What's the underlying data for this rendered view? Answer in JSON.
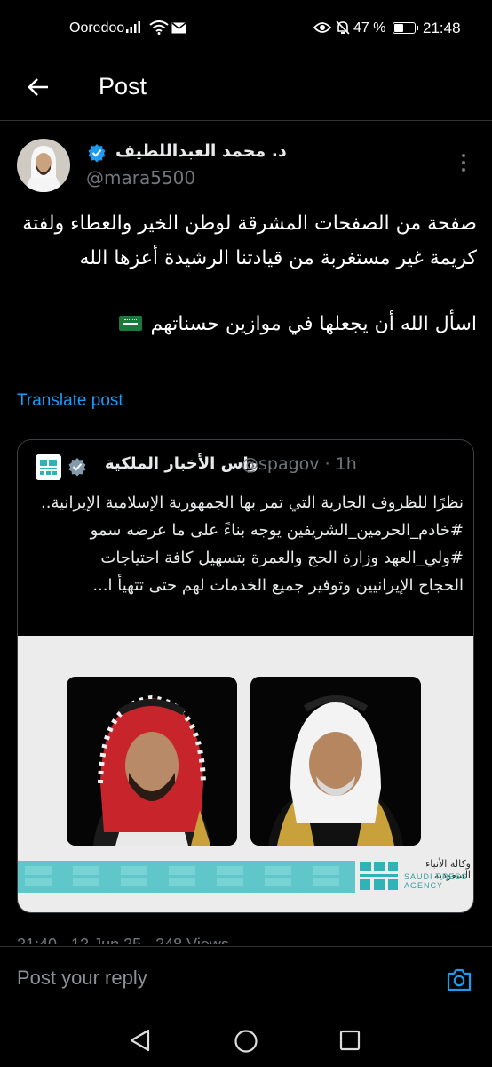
{
  "status_bar": {
    "carrier": "Ooredoo",
    "battery_percent": "47 %",
    "battery_level": 0.47,
    "time": "21:48",
    "icons": [
      "signal-icon",
      "wifi-icon",
      "mail-icon",
      "eye-icon",
      "bell-off-icon",
      "battery-icon"
    ]
  },
  "header": {
    "title": "Post",
    "back_icon": "arrow-left-icon"
  },
  "post": {
    "author_name": "د. محمد العبداللطيف",
    "handle": "@mara5500",
    "text_paragraph_1": "صفحة من الصفحات المشرقة لوطن الخير والعطاء ولفتة كريمة غير مستغربة من قيادتنا الرشيدة أعزها الله",
    "text_paragraph_2": "اسأل الله أن يجعلها في موازين حسناتهم",
    "translate_label": "Translate post"
  },
  "quoted_post": {
    "author_name": "واس الأخبار الملكية",
    "handle_time": "@spagov · 1h",
    "text_line_1": "نظرًا للظروف الجارية التي تمر بها الجمهورية الإسلامية الإيرانية..",
    "text_line_2": "#خادم_الحرمين_الشريفين يوجه بناءً على ما عرضه سمو",
    "text_line_3": "#ولي_العهد وزارة الحج والعمرة بتسهيل كافة احتياجات",
    "text_line_4": "الحجاج الإيرانيين وتوفير جميع الخدمات لهم حتى تتهيأ ا...",
    "image": {
      "agency_name_ar": "وكالة الأنباء السعودية",
      "agency_name_en": "SAUDI PRESS AGENCY",
      "logo_text": "SPA"
    }
  },
  "meta": "21:40 · 12 Jun 25 · 248 Views",
  "reply": {
    "placeholder": "Post your reply"
  },
  "nav": {
    "icons": [
      "nav-back-icon",
      "nav-home-icon",
      "nav-recent-icon"
    ]
  },
  "colors": {
    "background": "#000000",
    "accent": "#1d9bf0",
    "secondary_text": "#71767b",
    "spa_teal": "#5fc7c9"
  }
}
